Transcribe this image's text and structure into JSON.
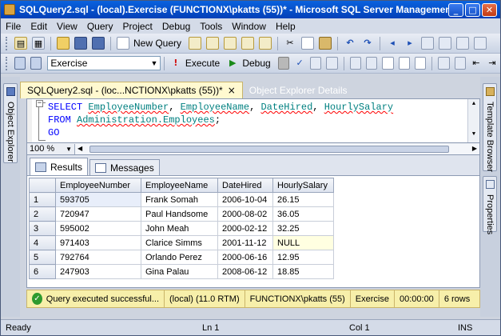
{
  "window": {
    "title": "SQLQuery2.sql - (local).Exercise (FUNCTIONX\\pkatts (55))* - Microsoft SQL Server Managemen",
    "minimize": "_",
    "maximize": "□",
    "close": "✕"
  },
  "menu": [
    "File",
    "Edit",
    "View",
    "Query",
    "Project",
    "Debug",
    "Tools",
    "Window",
    "Help"
  ],
  "toolbar": {
    "new_query": "New Query",
    "database": "Exercise",
    "execute": "Execute",
    "debug": "Debug"
  },
  "dock": {
    "left": "Object Explorer",
    "right_top": "Template Browser",
    "right_bottom": "Properties"
  },
  "doc_tabs": {
    "active": "SQLQuery2.sql - (loc...NCTIONX\\pkatts (55))*",
    "inactive": "Object Explorer Details",
    "close": "×"
  },
  "editor": {
    "line1": {
      "kw": "SELECT",
      "cols": [
        "EmployeeNumber",
        "EmployeeName",
        "DateHired",
        "HourlySalary"
      ]
    },
    "line2": {
      "kw": "FROM",
      "table": "Administration.Employees",
      "end": ";"
    },
    "line3": {
      "kw": "GO"
    }
  },
  "zoom": "100 %",
  "results": {
    "tabs": [
      "Results",
      "Messages"
    ],
    "columns": [
      "EmployeeNumber",
      "EmployeeName",
      "DateHired",
      "HourlySalary"
    ],
    "rows": [
      [
        "1",
        "593705",
        "Frank Somah",
        "2006-10-04",
        "26.15"
      ],
      [
        "2",
        "720947",
        "Paul Handsome",
        "2000-08-02",
        "36.05"
      ],
      [
        "3",
        "595002",
        "John Meah",
        "2000-02-12",
        "32.25"
      ],
      [
        "4",
        "971403",
        "Clarice Simms",
        "2001-11-12",
        "NULL"
      ],
      [
        "5",
        "792764",
        "Orlando Perez",
        "2000-06-16",
        "12.95"
      ],
      [
        "6",
        "247903",
        "Gina Palau",
        "2008-06-12",
        "18.85"
      ]
    ]
  },
  "query_status": {
    "message": "Query executed successful...",
    "server": "(local) (11.0 RTM)",
    "user": "FUNCTIONX\\pkatts (55)",
    "database": "Exercise",
    "time": "00:00:00",
    "rows": "6 rows"
  },
  "status": {
    "ready": "Ready",
    "ln": "Ln 1",
    "col": "Col 1",
    "ins": "INS"
  },
  "colors": {
    "title": "#0a62de",
    "query_status": "#f7efaa",
    "keyword": "#0000ff",
    "identifier": "#008080"
  }
}
